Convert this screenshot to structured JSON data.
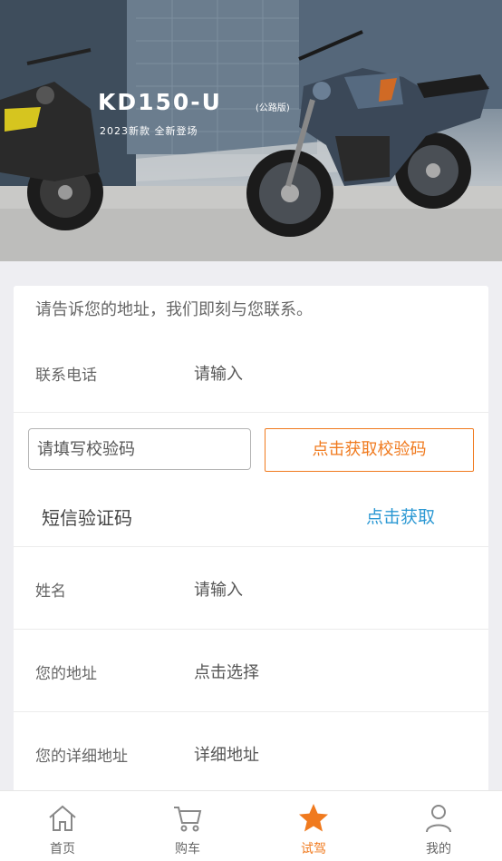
{
  "banner": {
    "model": "KD150-U",
    "model_note": "(公路版)",
    "subtitle": "2023新款 全新登场"
  },
  "form": {
    "intro": "请告诉您的地址，我们即刻与您联系。",
    "phone": {
      "label": "联系电话",
      "placeholder": "请输入"
    },
    "verify": {
      "placeholder": "请填写校验码",
      "button": "点击获取校验码"
    },
    "sms": {
      "label": "短信验证码",
      "action": "点击获取"
    },
    "name": {
      "label": "姓名",
      "placeholder": "请输入"
    },
    "address": {
      "label": "您的地址",
      "value": "点击选择"
    },
    "detail_address": {
      "label": "您的详细地址",
      "placeholder": "详细地址"
    }
  },
  "tabbar": {
    "items": [
      {
        "label": "首页",
        "icon": "home-icon"
      },
      {
        "label": "购车",
        "icon": "cart-icon"
      },
      {
        "label": "试驾",
        "icon": "star-icon"
      },
      {
        "label": "我的",
        "icon": "user-icon"
      }
    ],
    "active_index": 2
  },
  "colors": {
    "accent": "#f07a1e",
    "link": "#2b98d3"
  }
}
